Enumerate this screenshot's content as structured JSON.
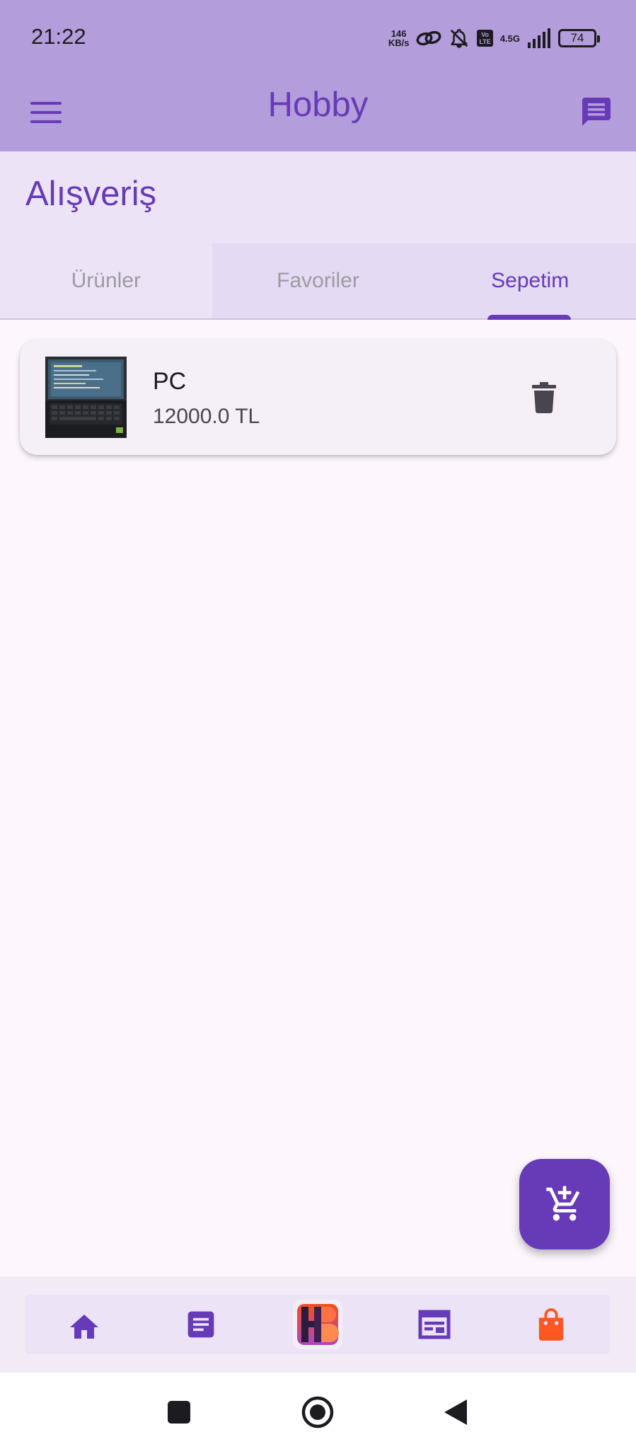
{
  "status_bar": {
    "time": "21:22",
    "net_speed_value": "146",
    "net_speed_unit": "KB/s",
    "lte_top": "Vo",
    "lte_bottom": "LTE",
    "network_type": "4.5G",
    "battery_level": "74"
  },
  "app_bar": {
    "title": "Hobby",
    "menu_icon": "menu-icon",
    "chat_icon": "chat-icon"
  },
  "page": {
    "title": "Alışveriş"
  },
  "tabs": [
    {
      "label": "Ürünler",
      "active": false
    },
    {
      "label": "Favoriler",
      "active": false
    },
    {
      "label": "Sepetim",
      "active": true
    }
  ],
  "cart": {
    "items": [
      {
        "name": "PC",
        "price": "12000.0 TL",
        "image": "laptop-photo",
        "action_icon": "trash-icon"
      }
    ]
  },
  "fab": {
    "icon": "add-shopping-cart-icon"
  },
  "bottom_nav": {
    "items": [
      {
        "icon": "home-icon"
      },
      {
        "icon": "article-icon"
      },
      {
        "icon": "hobby-logo"
      },
      {
        "icon": "calendar-view-icon"
      },
      {
        "icon": "shopping-bag-icon",
        "active": true
      }
    ]
  },
  "system_nav": {
    "items": [
      "recents-square-icon",
      "home-circle-icon",
      "back-triangle-icon"
    ]
  },
  "colors": {
    "primary": "#673ab7",
    "app_bar": "#b39ddb",
    "header_bg": "#ece4f6",
    "background": "#fdf7fd",
    "accent_active": "#ff5722"
  }
}
